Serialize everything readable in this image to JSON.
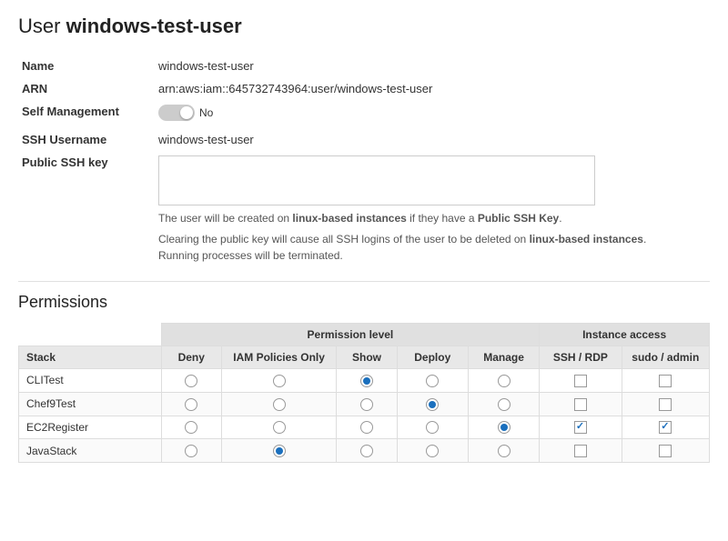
{
  "page": {
    "title_prefix": "User ",
    "title_bold": "windows-test-user"
  },
  "user_info": {
    "name_label": "Name",
    "name_value": "windows-test-user",
    "arn_label": "ARN",
    "arn_value": "arn:aws:iam::645732743964:user/windows-test-user",
    "self_management_label": "Self Management",
    "self_management_value": "No",
    "ssh_username_label": "SSH Username",
    "ssh_username_value": "windows-test-user",
    "public_ssh_key_label": "Public SSH key",
    "ssh_key_placeholder": "",
    "note1": "The user will be created on linux-based instances if they have a Public SSH Key.",
    "note2": "Clearing the public key will cause all SSH logins of the user to be deleted on linux-based instances. Running processes will be terminated."
  },
  "permissions": {
    "section_title": "Permissions",
    "group_permission_level": "Permission level",
    "group_instance_access": "Instance access",
    "col_stack": "Stack",
    "col_deny": "Deny",
    "col_iam": "IAM Policies Only",
    "col_show": "Show",
    "col_deploy": "Deploy",
    "col_manage": "Manage",
    "col_ssh": "SSH / RDP",
    "col_sudo": "sudo / admin",
    "rows": [
      {
        "stack": "CLITest",
        "deny": false,
        "iam": false,
        "show": true,
        "deploy": false,
        "manage": false,
        "ssh": false,
        "sudo": false
      },
      {
        "stack": "Chef9Test",
        "deny": false,
        "iam": false,
        "show": false,
        "deploy": true,
        "manage": false,
        "ssh": false,
        "sudo": false
      },
      {
        "stack": "EC2Register",
        "deny": false,
        "iam": false,
        "show": false,
        "deploy": false,
        "manage": true,
        "ssh": true,
        "sudo": true
      },
      {
        "stack": "JavaStack",
        "deny": false,
        "iam": true,
        "show": false,
        "deploy": false,
        "manage": false,
        "ssh": false,
        "sudo": false
      }
    ]
  }
}
